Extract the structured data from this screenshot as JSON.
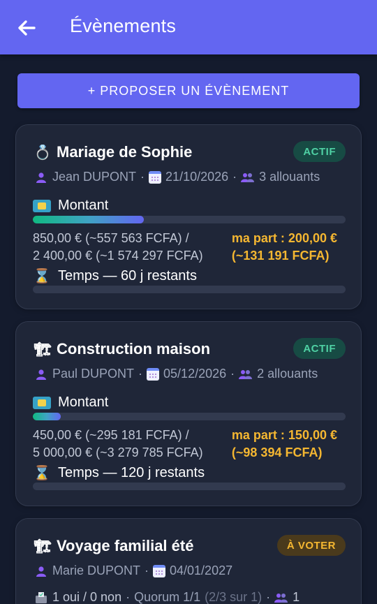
{
  "appbar": {
    "title": "Évènements",
    "back_icon": "arrow-left-icon"
  },
  "propose_button": {
    "label": "+ PROPOSER UN ÉVÈNEMENT"
  },
  "colors": {
    "primary": "#6366f1",
    "background": "#141b2d",
    "card": "#1f2638",
    "active_badge": "#4fd1a4",
    "vote_badge": "#f5b731",
    "highlight": "#f5b731"
  },
  "events": [
    {
      "emoji": "💍",
      "title": "Mariage de Sophie",
      "badge": "ACTIF",
      "organizer": "Jean DUPONT",
      "date": "21/10/2026",
      "participants": "3 allouants",
      "amount_label": "Montant",
      "progress_fraction": 0.354,
      "amount_line1": "850,00 € (~557 563 FCFA) /",
      "amount_line2": "2 400,00 € (~1 574 297 FCFA)",
      "share_line1": "ma part : 200,00 €",
      "share_line2": "(~131 191 FCFA)",
      "time_label": "Temps — 60 j restants",
      "time_fraction": 0
    },
    {
      "emoji": "🏗",
      "title": "Construction maison",
      "badge": "ACTIF",
      "organizer": "Paul DUPONT",
      "date": "05/12/2026",
      "participants": "2 allouants",
      "amount_label": "Montant",
      "progress_fraction": 0.09,
      "amount_line1": "450,00 € (~295 181 FCFA) /",
      "amount_line2": "5 000,00 € (~3 279 785 FCFA)",
      "share_line1": "ma part : 150,00 €",
      "share_line2": "(~98 394 FCFA)",
      "time_label": "Temps — 120 j restants",
      "time_fraction": 0
    },
    {
      "emoji": "🏗",
      "title": "Voyage familial été",
      "badge": "À VOTER",
      "organizer": "Marie DUPONT",
      "date": "04/01/2027",
      "votes": "1 oui / 0 non",
      "quorum": "Quorum 1/1",
      "quorum_detail": "(2/3 sur 1)",
      "participants": "1"
    }
  ]
}
